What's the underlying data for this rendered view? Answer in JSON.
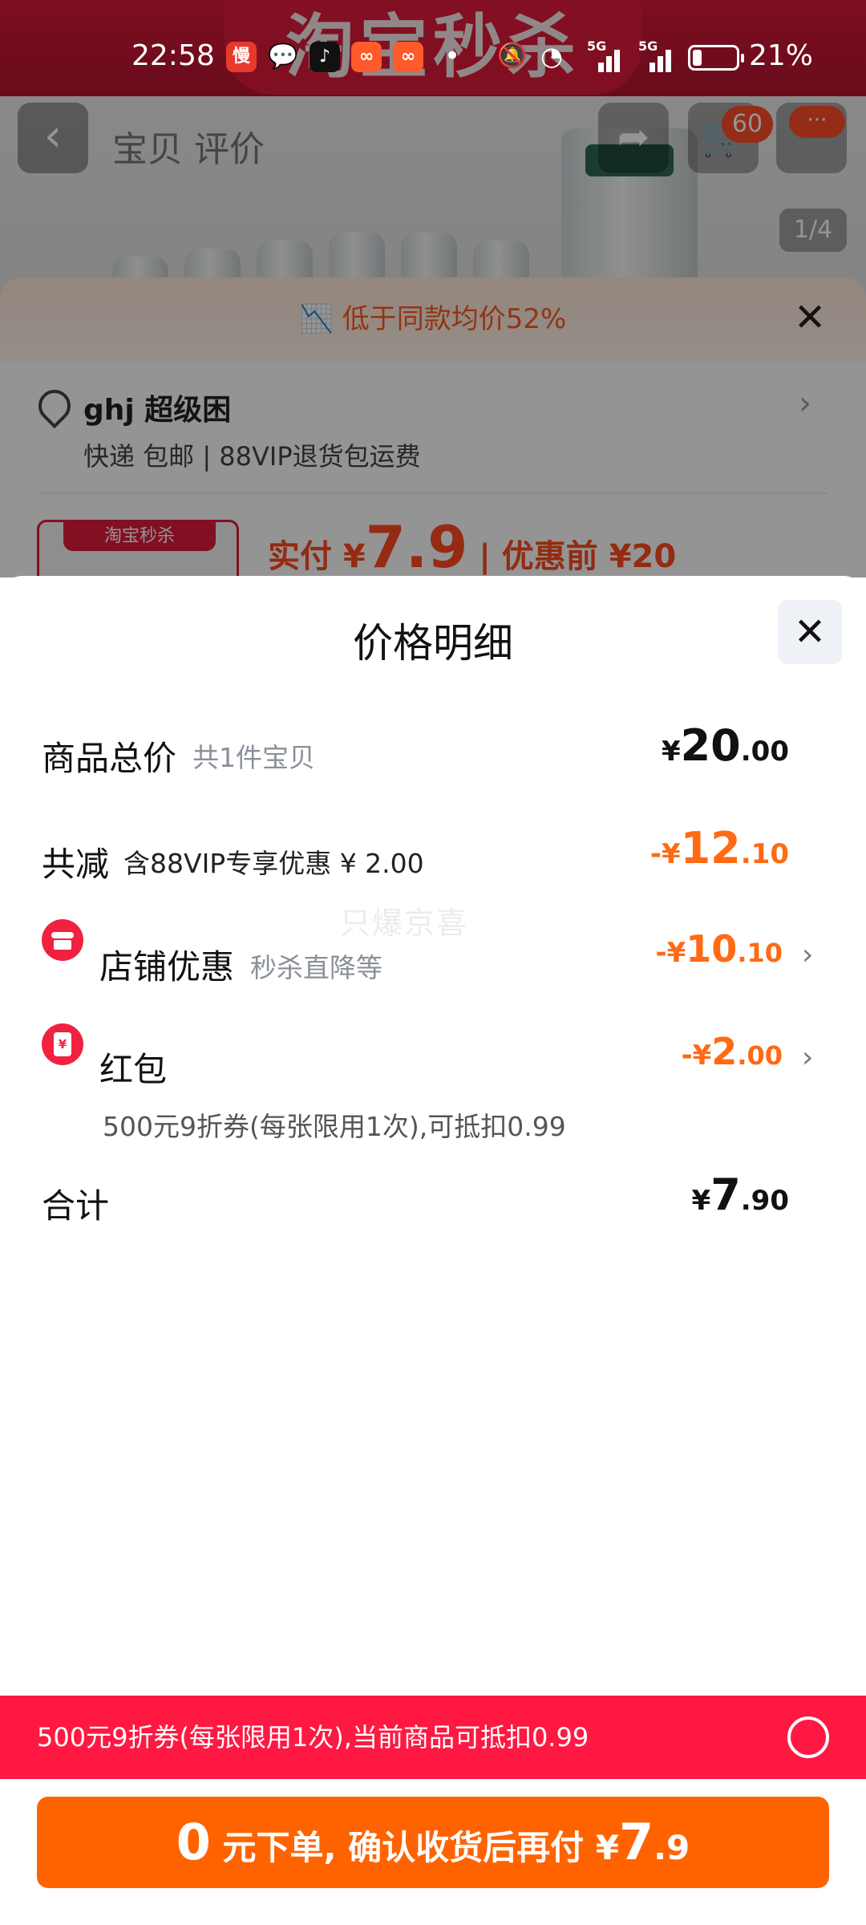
{
  "status_bar": {
    "time": "22:58",
    "battery_pct": "21%",
    "battery_level": 0.21,
    "app_icons": [
      "manbu-app-icon",
      "wechat-icon",
      "douyin-icon",
      "xiaohongshu-icon",
      "xiaohongshu-icon"
    ],
    "signal_labels": [
      "5G",
      "5G"
    ]
  },
  "background": {
    "banner_text": "淘宝秒杀",
    "page_title": "宝贝 评价",
    "cart_badge": "60",
    "more_badge": "···",
    "image_pager": "1/4",
    "price_tip": "低于同款均价52%",
    "address": "ghj 超级困",
    "shipping": "快递 包邮 | 88VIP退货包运费",
    "thumb_label": "淘宝秒杀",
    "pay_label": "实付 ¥",
    "pay_int": "7.9",
    "pay_before": "| 优惠前 ¥20"
  },
  "panel": {
    "title": "价格明细",
    "close_glyph": "✕",
    "watermark": "只爆京喜",
    "rows": {
      "total": {
        "label": "商品总价",
        "sub": "共1件宝贝",
        "currency": "¥",
        "int": "20",
        "dec": ".00"
      },
      "discount": {
        "label": "共减",
        "sub": "含88VIP专享优惠 ¥ 2.00",
        "prefix": "-¥",
        "int": "12",
        "dec": ".10"
      },
      "shop": {
        "label": "店铺优惠",
        "sub": "秒杀直降等",
        "prefix": "-¥",
        "int": "10",
        "dec": ".10"
      },
      "redpack": {
        "label": "红包",
        "sub": "500元9折券(每张限用1次),可抵扣0.99",
        "prefix": "-¥",
        "int": "2",
        "dec": ".00"
      },
      "sum": {
        "label": "合计",
        "currency": "¥",
        "int": "7",
        "dec": ".90"
      }
    }
  },
  "coupon_bar": {
    "text": "500元9折券(每张限用1次),当前商品可抵扣0.99"
  },
  "cta": {
    "zero": "0",
    "text1": "元下单, 确认收货后再付 ¥",
    "int": "7",
    "dec": ".9"
  },
  "colors": {
    "accent_orange": "#ff6300",
    "discount_orange": "#ff6a14",
    "coupon_red": "#ff1942",
    "icon_red": "#f0223f"
  }
}
